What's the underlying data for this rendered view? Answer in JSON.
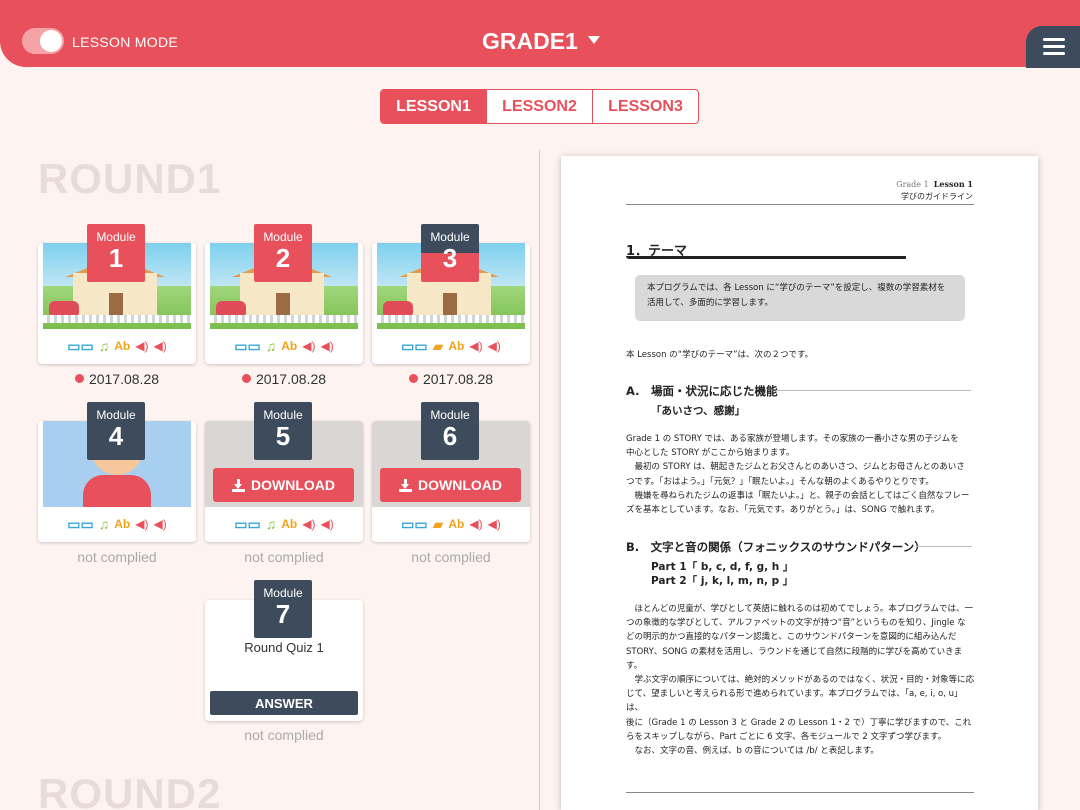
{
  "header": {
    "mode_label": "LESSON MODE",
    "grade_label": "GRADE1",
    "toggle_on": true
  },
  "tabs": [
    {
      "label": "LESSON1",
      "active": true
    },
    {
      "label": "LESSON2",
      "active": false
    },
    {
      "label": "LESSON3",
      "active": false
    }
  ],
  "rounds": {
    "round1": "ROUND1",
    "round2": "ROUND2"
  },
  "modules": [
    {
      "label": "Module",
      "number": "1",
      "status": "2017.08.28",
      "badge_color": "#e8505b"
    },
    {
      "label": "Module",
      "number": "2",
      "status": "2017.08.28",
      "badge_color": "#e8505b"
    },
    {
      "label": "Module",
      "number": "3",
      "status": "2017.08.28",
      "badge_color": "#3d4b5c"
    },
    {
      "label": "Module",
      "number": "4",
      "status": "not complied",
      "badge_color": "#3d4b5c"
    },
    {
      "label": "Module",
      "number": "5",
      "status": "not complied",
      "badge_color": "#3d4b5c",
      "action": "DOWNLOAD"
    },
    {
      "label": "Module",
      "number": "6",
      "status": "not complied",
      "badge_color": "#3d4b5c",
      "action": "DOWNLOAD"
    },
    {
      "label": "Module",
      "number": "7",
      "status": "not complied",
      "badge_color": "#3d4b5c",
      "title": "Round Quiz 1",
      "action": "ANSWER"
    }
  ],
  "icons": {
    "book": "📖",
    "music": "♫",
    "ab": "Ab",
    "sound": "◀)",
    "clap": "🎬"
  },
  "document": {
    "head_grade": "Grade 1",
    "head_lesson": "Lesson 1",
    "head_sub": "学びのガイドライン",
    "theme": "1．テーマ",
    "box_text": "本プログラムでは、各 Lesson に“学びのテーマ”を設定し、複数の学習素材を活用して、多面的に学習します。",
    "intro": "本 Lesson の“学びのテーマ”は、次の２つです。",
    "sec_a_title": "A.　場面・状況に応じた機能",
    "sec_a_sub": "「あいさつ、感謝」",
    "sec_a_body": [
      "Grade 1 の STORY では、ある家族が登場します。その家族の一番小さな男の子ジムを",
      "中心とした STORY がここから始まります。",
      "　最初の STORY は、朝起きたジムとお父さんとのあいさつ、ジムとお母さんとのあいさ",
      "つです。「おはよう。」「元気？」「眠たいよ。」そんな朝のよくあるやりとりです。",
      "　機嫌を尋ねられたジムの返事は「眠たいよ。」と、親子の会話としてはごく自然なフレー",
      "ズを基本としています。なお、「元気です。ありがとう。」は、SONG で触れます。"
    ],
    "sec_b_title": "B.　文字と音の関係（フォニックスのサウンドパターン）",
    "sec_b_part1": "Part 1「 b, c, d, f, g, h 」",
    "sec_b_part2": "Part 2「 j, k, l, m, n, p 」",
    "sec_b_body": [
      "　ほとんどの児童が、学びとして英語に触れるのは初めてでしょう。本プログラムでは、一",
      "つの象徴的な学びとして、アルファベットの文字が持つ“音”というものを知り、Jingle な",
      "どの明示的かつ直接的なパターン認識と、このサウンドパターンを意図的に組み込んだ",
      "STORY、SONG の素材を活用し、ラウンドを通じて自然に段階的に学びを高めていきます。",
      "　学ぶ文字の順序については、絶対的メソッドがあるのではなく、状況・目的・対象等に応",
      "じて、望ましいと考えられる形で進められています。本プログラムでは、「a, e, i, o, u」は、",
      "後に（Grade 1 の Lesson 3 と Grade 2 の Lesson 1・2 で）丁寧に学びますので、これ",
      "らをスキップしながら、Part ごとに 6 文字、各モジュールで 2 文字ずつ学びます。",
      "　なお、文字の音、例えば、b の音については /b/ と表記します。"
    ]
  },
  "colors": {
    "brand_red": "#e8505b",
    "dark_slate": "#3d4b5c",
    "background": "#fdf3f1"
  }
}
